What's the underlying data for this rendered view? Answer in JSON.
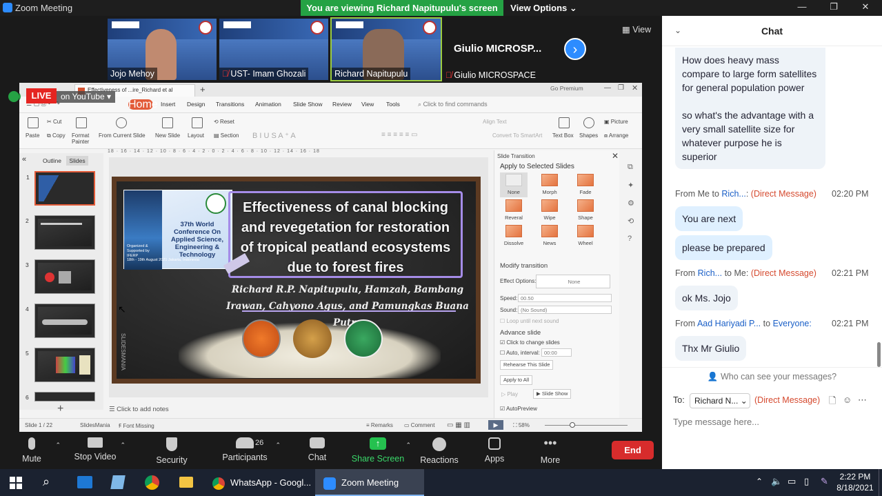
{
  "window": {
    "title": "Zoom Meeting",
    "viewing_banner": "You are viewing Richard Napitupulu's screen",
    "view_options": "View Options"
  },
  "gallery": {
    "tiles": [
      {
        "name": "Jojo Mehoy",
        "muted": false
      },
      {
        "name": "UST- Imam Ghozali",
        "muted": true
      },
      {
        "name": "Richard Napitupulu",
        "muted": false
      },
      {
        "name": "Giulio MICROSPACE",
        "muted": true
      }
    ],
    "giulio_big": "Giulio  MICROSP...",
    "view_label": "View"
  },
  "shared": {
    "live": "LIVE",
    "youtube": "on YouTube",
    "file_tab": "Effectiveness of ...ire_Richard et al",
    "go_premium": "Go Premium",
    "menu_tabs": [
      "Home",
      "Insert",
      "Design",
      "Transitions",
      "Animation",
      "Slide Show",
      "Review",
      "View",
      "Tools"
    ],
    "find_commands": "Click to find commands",
    "ribbon": {
      "paste": "Paste",
      "cut": "Cut",
      "copy": "Copy",
      "format_painter": "Format Painter",
      "from_current": "From Current Slide",
      "new_slide": "New Slide",
      "layout": "Layout",
      "reset": "Reset",
      "section": "Section",
      "align_text": "Align Text",
      "convert_smartart": "Convert To SmartArt",
      "text_box": "Text Box",
      "shapes": "Shapes",
      "picture": "Picture",
      "arrange": "Arrange"
    },
    "ruler": "18 · 16 · 14 · 12 · 10 · 8 · 6 · 4 · 2 · 0 · 2 · 4 · 6 · 8 · 10 · 12 · 14 · 16 · 18",
    "left_tabs": {
      "outline": "Outline",
      "slides": "Slides"
    },
    "slide_numbers": [
      "1",
      "2",
      "3",
      "4",
      "5",
      "6"
    ],
    "slide": {
      "title": "Effectiveness of canal blocking and revegetation for restoration of tropical peatland ecosystems due to forest fires",
      "authors": "Richard R.P. Napitupulu, Hamzah, Bambang Irawan, Cahyono Agus, and Pamungkas Buana Putra",
      "banner_conf": "37th World Conference On Applied Science, Engineering & Technology",
      "banner_org": "Organized & Supported by IFERP",
      "banner_date": "18th - 19th August 2021 Jakarta, Indonesia",
      "side_text": "SLIDESMANIA"
    },
    "notes": "Click to add notes",
    "transition": {
      "title": "Slide Transition",
      "apply_to_selected": "Apply to Selected Slides",
      "effects": [
        "None",
        "Morph",
        "Fade",
        "Reveral",
        "Wipe",
        "Shape",
        "Dissolve",
        "News",
        "Wheel"
      ],
      "modify": "Modify transition",
      "effect_options": "Effect Options:",
      "effect_value": "None",
      "speed_label": "Speed:",
      "speed_value": "00.50",
      "sound_label": "Sound:",
      "sound_value": "(No Sound)",
      "loop": "Loop until next sound",
      "advance": "Advance slide",
      "click_change": "Click to change slides",
      "auto_interval": "Auto, interval:",
      "auto_value": "00:00",
      "rehearse": "Rehearse This Slide",
      "apply_all": "Apply to All",
      "play": "Play",
      "slideshow": "Slide Show",
      "autopreview": "AutoPreview"
    },
    "status": {
      "slide_of": "Slide 1 / 22",
      "theme": "SlidesMania",
      "font_missing": "Font Missing",
      "remarks": "Remarks",
      "comment": "Comment",
      "zoom": "58%"
    }
  },
  "chat": {
    "title": "Chat",
    "first_bubble_a": "How does heavy mass compare to large form satellites for general population power",
    "first_bubble_b": "so what's the advantage with a very small satellite size for whatever purpose he is superior",
    "messages": [
      {
        "from": "From Me to",
        "sender": "Rich...",
        "to": ":",
        "dm": "(Direct Message)",
        "time": "02:20 PM",
        "texts": [
          "You are next",
          "please be prepared"
        ]
      },
      {
        "from": "From",
        "sender": "Rich...",
        "to": "to Me:",
        "dm": "(Direct Message)",
        "time": "02:21 PM",
        "texts": [
          "ok Ms. Jojo"
        ]
      },
      {
        "from": "From",
        "sender": "Aad Hariyadi P...",
        "to": "to",
        "dm": "Everyone:",
        "time": "02:21 PM",
        "texts": [
          "Thx Mr Giulio"
        ]
      }
    ],
    "who_can_see": "Who can see your messages?",
    "to_label": "To:",
    "to_value": "Richard N...",
    "to_dm": "(Direct Message)",
    "input_placeholder": "Type message here..."
  },
  "toolbar": {
    "mute": "Mute",
    "stop_video": "Stop Video",
    "security": "Security",
    "participants": "Participants",
    "participants_count": "26",
    "chat": "Chat",
    "share_screen": "Share Screen",
    "reactions": "Reactions",
    "apps": "Apps",
    "more": "More",
    "end": "End"
  },
  "taskbar": {
    "whatsapp": "WhatsApp - Googl...",
    "zoom": "Zoom Meeting",
    "time": "2:22 PM",
    "date": "8/18/2021"
  },
  "colors": {
    "zoom_blue": "#2d8cff",
    "viewing_green": "#25a244",
    "end_red": "#d72c2c",
    "dm_red": "#d5492e",
    "ppt_accent": "#e35b39"
  }
}
